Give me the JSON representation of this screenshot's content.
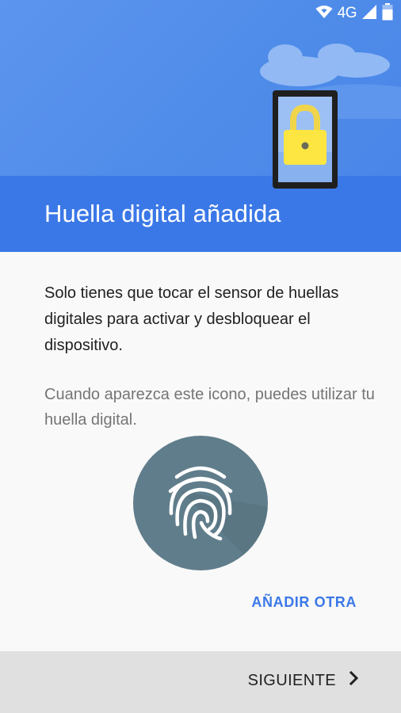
{
  "status_bar": {
    "network_label": "4G",
    "icons": [
      "wifi-icon",
      "cell-signal-icon",
      "battery-icon"
    ]
  },
  "header": {
    "title": "Huella digital añadida",
    "illustration": "phone-with-padlock-illustration"
  },
  "main": {
    "description": "Solo tienes que tocar el sensor de huellas digitales para activar y desbloquear el dispositivo.",
    "hint": "Cuando aparezca este icono, puedes utilizar tu huella digital.",
    "fingerprint_icon": "fingerprint-icon",
    "add_another_label": "AÑADIR OTRA"
  },
  "footer": {
    "next_label": "SIGUIENTE",
    "next_icon": "chevron-right-icon"
  },
  "colors": {
    "header_blue": "#4a86e8",
    "title_band_blue": "#3b78e7",
    "accent_blue": "#3b78e7",
    "fingerprint_circle": "#607d8b",
    "padlock_yellow": "#fde542",
    "footer_gray": "#e0e0e0"
  }
}
